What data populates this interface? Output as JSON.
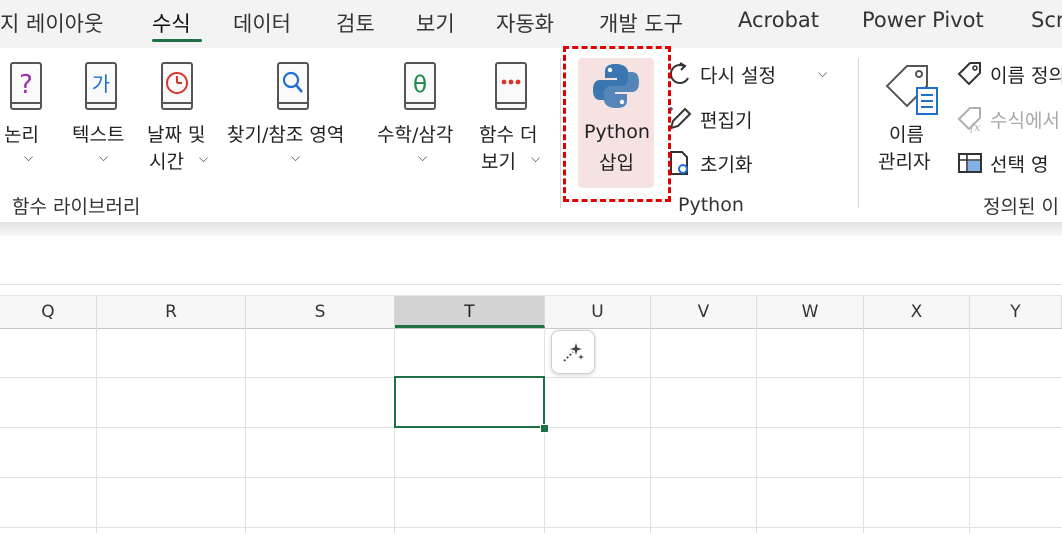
{
  "tabs": [
    {
      "label": "지 레이아웃"
    },
    {
      "label": "수식",
      "active": true
    },
    {
      "label": "데이터"
    },
    {
      "label": "검토"
    },
    {
      "label": "보기"
    },
    {
      "label": "자동화"
    },
    {
      "label": "개발 도구"
    },
    {
      "label": "Acrobat"
    },
    {
      "label": "Power Pivot"
    },
    {
      "label": "Scr"
    }
  ],
  "colors": {
    "accent": "#1e7145",
    "highlight_border": "#e00000",
    "python_bg": "#f7e2e2"
  },
  "function_library": {
    "group_label": "함수 라이브러리",
    "buttons": [
      {
        "line1": "논리",
        "line2": "",
        "icon": "logical-book-icon"
      },
      {
        "line1": "텍스트",
        "line2": "",
        "icon": "text-book-icon"
      },
      {
        "line1": "날짜 및",
        "line2": "시간",
        "icon": "datetime-book-icon"
      },
      {
        "line1": "찾기/참조 영역",
        "line2": "",
        "icon": "lookup-book-icon"
      },
      {
        "line1": "수학/삼각",
        "line2": "",
        "icon": "math-book-icon"
      },
      {
        "line1": "함수 더",
        "line2": "보기",
        "icon": "more-functions-book-icon"
      }
    ]
  },
  "python": {
    "group_label": "Python",
    "insert_line1": "Python",
    "insert_line2": "삽입",
    "reset_label": "다시 설정",
    "editor_label": "편집기",
    "initialize_label": "초기화"
  },
  "defined_names": {
    "group_label": "정의된 이",
    "name_manager_line1": "이름",
    "name_manager_line2": "관리자",
    "define_name_label": "이름 정의",
    "use_in_formula_label": "수식에서",
    "create_from_selection_label": "선택 영"
  },
  "grid": {
    "columns": [
      "Q",
      "R",
      "S",
      "T",
      "U",
      "V",
      "W",
      "X",
      "Y"
    ],
    "selected_column": "T"
  }
}
